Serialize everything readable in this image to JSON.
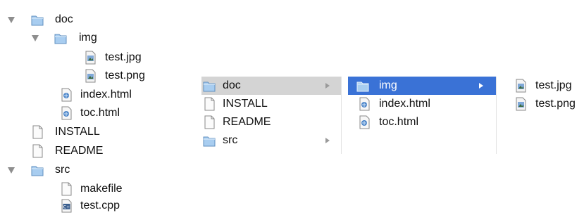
{
  "outline": [
    {
      "label": "doc",
      "type": "folder",
      "expanded": true
    },
    {
      "label": "img",
      "type": "folder",
      "expanded": true
    },
    {
      "label": "test.jpg",
      "type": "image"
    },
    {
      "label": "test.png",
      "type": "image"
    },
    {
      "label": "index.html",
      "type": "html"
    },
    {
      "label": "toc.html",
      "type": "html"
    },
    {
      "label": "INSTALL",
      "type": "document"
    },
    {
      "label": "README",
      "type": "document"
    },
    {
      "label": "src",
      "type": "folder",
      "expanded": true
    },
    {
      "label": "makefile",
      "type": "document"
    },
    {
      "label": "test.cpp",
      "type": "cpp-source"
    }
  ],
  "columns": [
    {
      "items": [
        {
          "label": "doc",
          "type": "folder",
          "selected": "inactive"
        },
        {
          "label": "INSTALL",
          "type": "document"
        },
        {
          "label": "README",
          "type": "document"
        },
        {
          "label": "src",
          "type": "folder"
        }
      ]
    },
    {
      "items": [
        {
          "label": "img",
          "type": "folder",
          "selected": "active"
        },
        {
          "label": "index.html",
          "type": "html"
        },
        {
          "label": "toc.html",
          "type": "html"
        }
      ]
    },
    {
      "items": [
        {
          "label": "test.jpg",
          "type": "image"
        },
        {
          "label": "test.png",
          "type": "image"
        }
      ]
    }
  ],
  "colors": {
    "selection_active": "#3a72d6",
    "selection_inactive": "#d4d4d4",
    "folder": "#a8cdf0",
    "disclosure": "#8e8e8e"
  }
}
